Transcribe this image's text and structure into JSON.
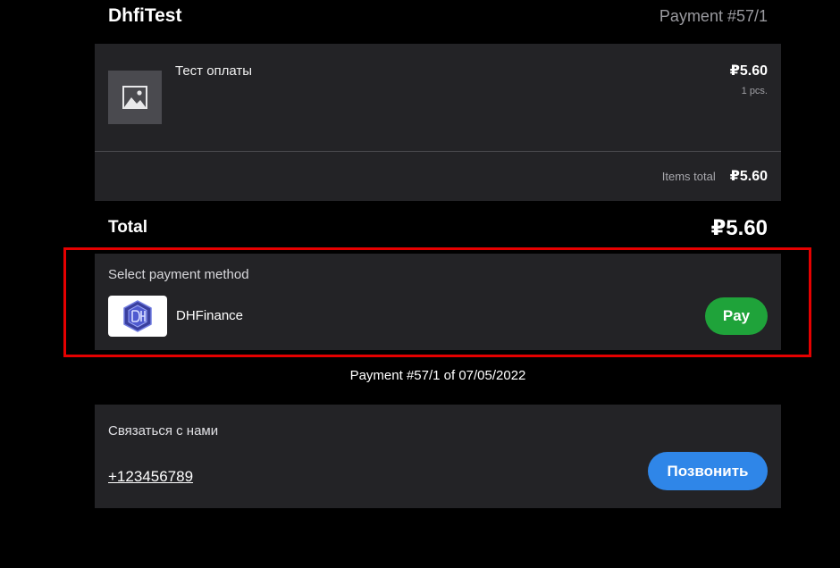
{
  "header": {
    "shop_name": "DhfiTest",
    "payment_number": "Payment #57/1"
  },
  "items": [
    {
      "icon": "image-placeholder-icon",
      "name": "Тест оплаты",
      "price": "₽5.60",
      "quantity": "1 pcs."
    }
  ],
  "items_total": {
    "label": "Items total",
    "value": "₽5.60"
  },
  "total": {
    "label": "Total",
    "value": "₽5.60"
  },
  "payment_method": {
    "title": "Select payment method",
    "method_name": "DHFinance",
    "logo_icon": "dhfinance-logo-icon",
    "pay_button": "Pay"
  },
  "payment_footer": "Payment #57/1 of 07/05/2022",
  "contact": {
    "title": "Связаться с нами",
    "phone": "+123456789",
    "call_button": "Позвонить"
  },
  "colors": {
    "background": "#000000",
    "card": "#232326",
    "pay_button": "#1fa33a",
    "call_button": "#2f86e8",
    "highlight": "#e50000"
  }
}
